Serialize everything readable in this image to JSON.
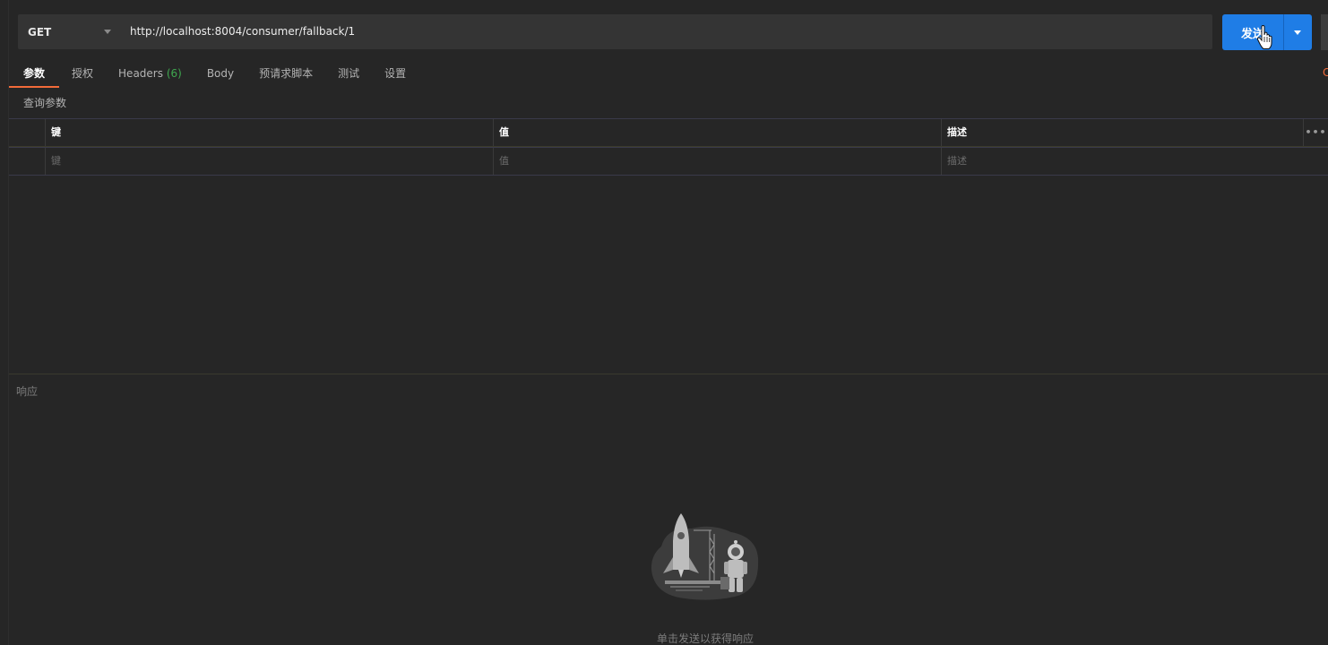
{
  "request": {
    "method": "GET",
    "url": "http://localhost:8004/consumer/fallback/1",
    "send_label": "发送"
  },
  "tabs": [
    {
      "label": "参数",
      "active": true
    },
    {
      "label": "授权"
    },
    {
      "label": "Headers",
      "count": "(6)"
    },
    {
      "label": "Body"
    },
    {
      "label": "预请求脚本"
    },
    {
      "label": "测试"
    },
    {
      "label": "设置"
    }
  ],
  "cookies_label": "C",
  "params": {
    "section_title": "查询参数",
    "headers": {
      "key": "键",
      "value": "值",
      "description": "描述",
      "more": "•••"
    },
    "placeholders": {
      "key": "键",
      "value": "值",
      "description": "描述"
    }
  },
  "response": {
    "title": "响应",
    "empty_message": "单击发送以获得响应"
  },
  "colors": {
    "background": "#262626",
    "accent_blue": "#1f7de6",
    "accent_orange": "#f26b3a",
    "count_green": "#3fa74f"
  }
}
